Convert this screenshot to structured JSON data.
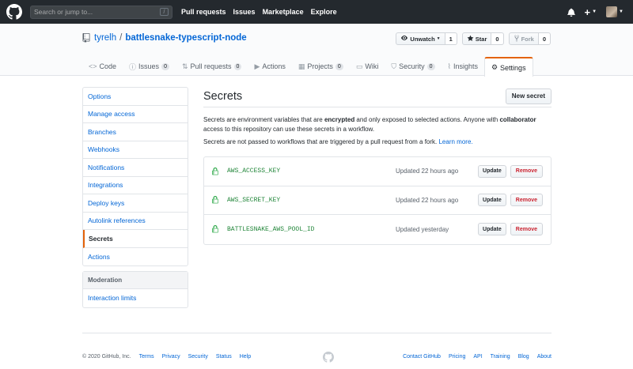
{
  "header": {
    "search_placeholder": "Search or jump to...",
    "slash_key": "/",
    "nav": [
      "Pull requests",
      "Issues",
      "Marketplace",
      "Explore"
    ],
    "plus_label": "+"
  },
  "repo": {
    "owner": "tyrelh",
    "separator": "/",
    "name": "battlesnake-typescript-node",
    "unwatch_label": "Unwatch",
    "unwatch_count": "1",
    "star_label": "Star",
    "star_count": "0",
    "fork_label": "Fork",
    "fork_count": "0"
  },
  "tabs": [
    {
      "label": "Code",
      "icon": "code-icon"
    },
    {
      "label": "Issues",
      "icon": "issue-icon",
      "count": "0"
    },
    {
      "label": "Pull requests",
      "icon": "pull-request-icon",
      "count": "0"
    },
    {
      "label": "Actions",
      "icon": "play-icon"
    },
    {
      "label": "Projects",
      "icon": "project-icon",
      "count": "0"
    },
    {
      "label": "Wiki",
      "icon": "book-icon"
    },
    {
      "label": "Security",
      "icon": "shield-icon",
      "count": "0"
    },
    {
      "label": "Insights",
      "icon": "graph-icon"
    },
    {
      "label": "Settings",
      "icon": "gear-icon"
    }
  ],
  "menu": {
    "items": [
      "Options",
      "Manage access",
      "Branches",
      "Webhooks",
      "Notifications",
      "Integrations",
      "Deploy keys",
      "Autolink references",
      "Secrets",
      "Actions"
    ],
    "moderation_heading": "Moderation",
    "moderation_items": [
      "Interaction limits"
    ]
  },
  "main": {
    "title": "Secrets",
    "new_secret_label": "New secret",
    "desc_part1": "Secrets are environment variables that are ",
    "desc_bold1": "encrypted",
    "desc_part2": " and only exposed to selected actions. Anyone with ",
    "desc_bold2": "collaborator",
    "desc_part3": " access to this repository can use these secrets in a workflow.",
    "desc2_text": "Secrets are not passed to workflows that are triggered by a pull request from a fork. ",
    "learn_more": "Learn more.",
    "secrets": [
      {
        "name": "AWS_ACCESS_KEY",
        "updated": "Updated 22 hours ago"
      },
      {
        "name": "AWS_SECRET_KEY",
        "updated": "Updated 22 hours ago"
      },
      {
        "name": "BATTLESNAKE_AWS_POOL_ID",
        "updated": "Updated yesterday"
      }
    ],
    "update_label": "Update",
    "remove_label": "Remove"
  },
  "footer": {
    "copyright": "© 2020 GitHub, Inc.",
    "left_links": [
      "Terms",
      "Privacy",
      "Security",
      "Status",
      "Help"
    ],
    "right_links": [
      "Contact GitHub",
      "Pricing",
      "API",
      "Training",
      "Blog",
      "About"
    ]
  },
  "colors": {
    "header_bg": "#24292e",
    "link": "#0366d6",
    "selected_accent": "#e36209",
    "secret_green": "#22863a",
    "remove_red": "#cb2431"
  }
}
